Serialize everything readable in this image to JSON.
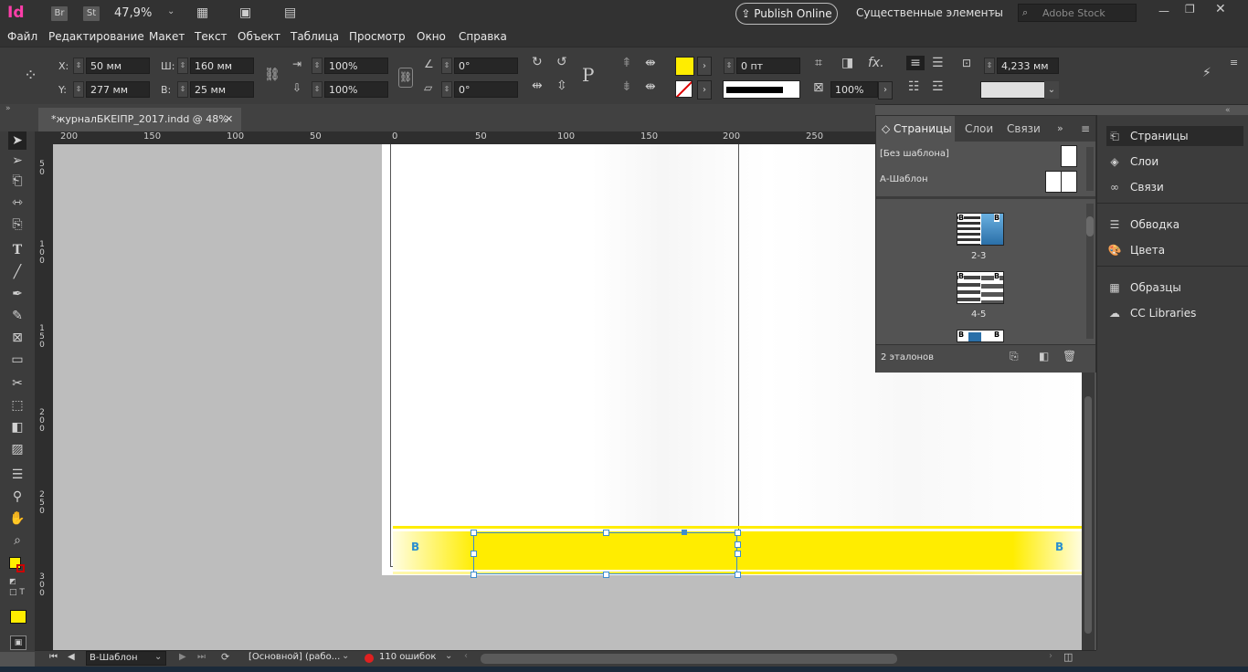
{
  "app": {
    "logo": "Id",
    "bridge": "Br",
    "stock_icon": "St",
    "zoom": "47,9%",
    "publish_online": "Publish Online",
    "workspace": "Существенные элементы",
    "search_placeholder": "Adobe Stock"
  },
  "menu": [
    "Файл",
    "Редактирование",
    "Макет",
    "Текст",
    "Объект",
    "Таблица",
    "Просмотр",
    "Окно",
    "Справка"
  ],
  "control": {
    "x_label": "X:",
    "x_value": "50 мм",
    "y_label": "Y:",
    "y_value": "277 мм",
    "w_label": "Ш:",
    "w_value": "160 мм",
    "h_label": "В:",
    "h_value": "25 мм",
    "scale_x": "100%",
    "scale_y": "100%",
    "rotate": "0°",
    "shear": "0°",
    "stroke_weight": "0 пт",
    "opacity": "100%",
    "offset": "4,233 мм",
    "fill_color": "#ffed00"
  },
  "document": {
    "tab_title": "*журналБКЕIПР_2017.indd @ 48%",
    "ruler_h": [
      "200",
      "150",
      "100",
      "50",
      "0",
      "50",
      "100",
      "150",
      "200",
      "250"
    ],
    "ruler_v": [
      "5\n0",
      "1\n0\n0",
      "1\n5\n0",
      "2\n0\n0",
      "2\n5\n0",
      "3\n0\n0"
    ],
    "page_marker_left": "B",
    "page_marker_right": "B"
  },
  "pages_panel": {
    "tabs": [
      "Страницы",
      "Слои",
      "Связи"
    ],
    "masters": [
      "[Без шаблона]",
      "А-Шаблон"
    ],
    "spreads": [
      "2-3",
      "4-5"
    ],
    "thumb_label": "B",
    "footer": "2 эталонов"
  },
  "dock": {
    "items": [
      "Страницы",
      "Слои",
      "Связи",
      "Обводка",
      "Цвета",
      "Образцы",
      "CC Libraries"
    ]
  },
  "status": {
    "master": "В-Шаблон",
    "profile": "[Основной] (рабо...",
    "errors": "110 ошибок"
  }
}
